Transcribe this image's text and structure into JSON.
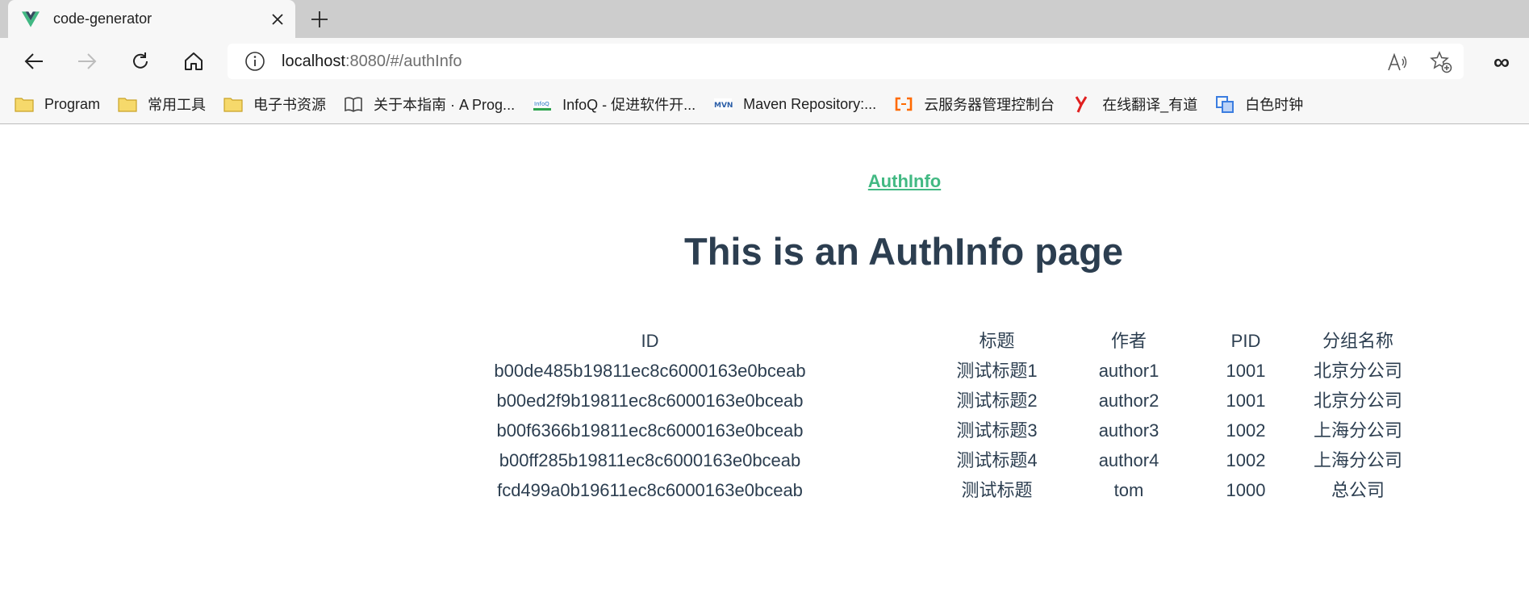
{
  "tab": {
    "title": "code-generator"
  },
  "address_bar": {
    "host": "localhost",
    "path": ":8080/#/authInfo"
  },
  "bookmarks": [
    {
      "label": "Program",
      "icon": "folder-icon"
    },
    {
      "label": "常用工具",
      "icon": "folder-icon"
    },
    {
      "label": "电子书资源",
      "icon": "folder-icon"
    },
    {
      "label": "关于本指南 · A Prog...",
      "icon": "book-icon"
    },
    {
      "label": "InfoQ - 促进软件开...",
      "icon": "infoq-icon"
    },
    {
      "label": "Maven Repository:...",
      "icon": "mvn-icon"
    },
    {
      "label": "云服务器管理控制台",
      "icon": "aliyun-icon"
    },
    {
      "label": "在线翻译_有道",
      "icon": "youdao-icon"
    },
    {
      "label": "白色时钟",
      "icon": "clock-app-icon"
    }
  ],
  "page": {
    "nav_link": "AuthInfo",
    "title": "This is an AuthInfo page",
    "table": {
      "headers": [
        "ID",
        "标题",
        "作者",
        "PID",
        "分组名称"
      ],
      "rows": [
        [
          "b00de485b19811ec8c6000163e0bceab",
          "测试标题1",
          "author1",
          "1001",
          "北京分公司"
        ],
        [
          "b00ed2f9b19811ec8c6000163e0bceab",
          "测试标题2",
          "author2",
          "1001",
          "北京分公司"
        ],
        [
          "b00f6366b19811ec8c6000163e0bceab",
          "测试标题3",
          "author3",
          "1002",
          "上海分公司"
        ],
        [
          "b00ff285b19811ec8c6000163e0bceab",
          "测试标题4",
          "author4",
          "1002",
          "上海分公司"
        ],
        [
          "fcd499a0b19611ec8c6000163e0bceab",
          "测试标题",
          "tom",
          "1000",
          "总公司"
        ]
      ]
    }
  },
  "colors": {
    "accent": "#42b983",
    "heading": "#2c3e50"
  }
}
